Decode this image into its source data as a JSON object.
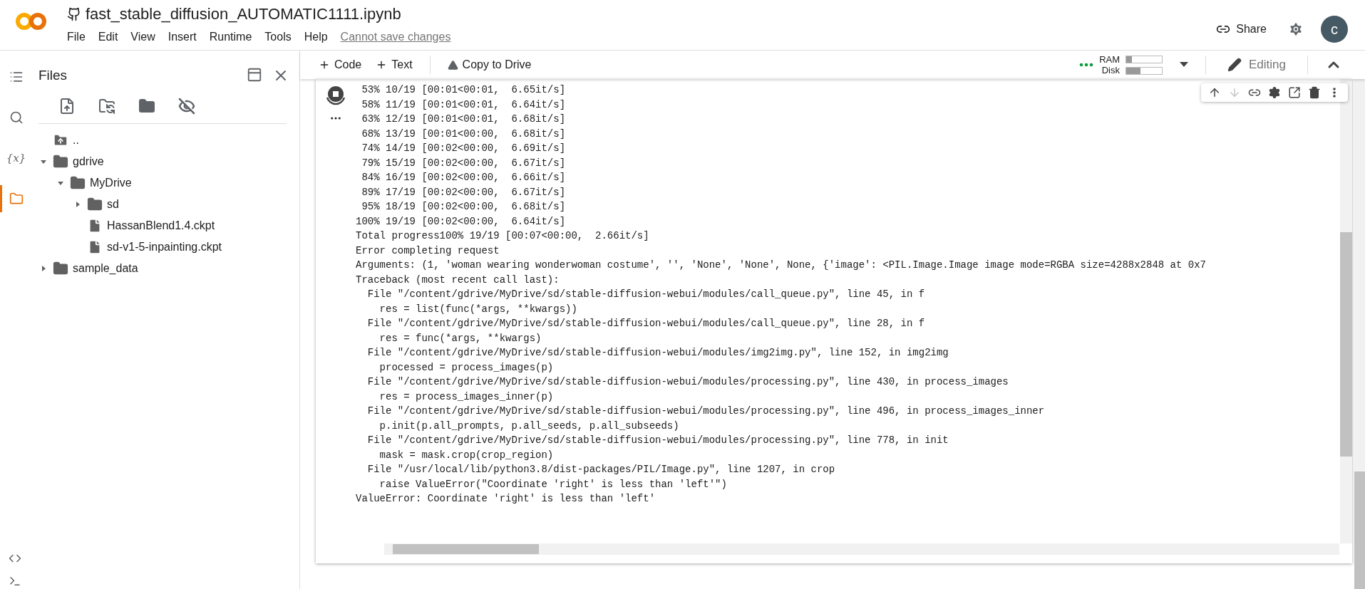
{
  "header": {
    "title": "fast_stable_diffusion_AUTOMATIC1111.ipynb",
    "menu": [
      "File",
      "Edit",
      "View",
      "Insert",
      "Runtime",
      "Tools",
      "Help"
    ],
    "save_notice": "Cannot save changes",
    "share": "Share",
    "avatar": "c"
  },
  "rail": [
    {
      "kind": "toc",
      "selected": false
    },
    {
      "kind": "search",
      "selected": false
    },
    {
      "kind": "variables",
      "glyph": "{x}",
      "selected": false
    },
    {
      "kind": "files",
      "selected": true
    }
  ],
  "files_panel": {
    "title": "Files",
    "tree": [
      {
        "kind": "up",
        "name": ".."
      },
      {
        "kind": "folder",
        "name": "gdrive",
        "expanded": true,
        "children": [
          {
            "kind": "folder",
            "name": "MyDrive",
            "expanded": true,
            "children": [
              {
                "kind": "folder",
                "name": "sd",
                "expanded": false
              },
              {
                "kind": "file",
                "name": "HassanBlend1.4.ckpt"
              },
              {
                "kind": "file",
                "name": "sd-v1-5-inpainting.ckpt"
              }
            ]
          }
        ]
      },
      {
        "kind": "folder",
        "name": "sample_data",
        "expanded": false
      }
    ]
  },
  "toolbar": {
    "buttons": [
      {
        "kind": "add",
        "label": "Code"
      },
      {
        "kind": "add",
        "label": "Text"
      },
      {
        "kind": "drive",
        "label": "Copy to Drive"
      }
    ],
    "ram": {
      "label": "RAM",
      "level": 0.15
    },
    "disk": {
      "label": "Disk",
      "level": 0.4
    },
    "editing": "Editing"
  },
  "cell_toolbar": [
    {
      "kind": "up",
      "disabled": false
    },
    {
      "kind": "down",
      "disabled": true
    },
    {
      "kind": "link",
      "disabled": false
    },
    {
      "kind": "settings",
      "disabled": false
    },
    {
      "kind": "mirror",
      "disabled": false
    },
    {
      "kind": "delete",
      "disabled": false
    },
    {
      "kind": "more",
      "disabled": false
    }
  ],
  "output": [
    " 53% 10/19 [00:01<00:01,  6.65it/s]",
    " 58% 11/19 [00:01<00:01,  6.64it/s]",
    " 63% 12/19 [00:01<00:01,  6.68it/s]",
    " 68% 13/19 [00:01<00:00,  6.68it/s]",
    " 74% 14/19 [00:02<00:00,  6.69it/s]",
    " 79% 15/19 [00:02<00:00,  6.67it/s]",
    " 84% 16/19 [00:02<00:00,  6.66it/s]",
    " 89% 17/19 [00:02<00:00,  6.67it/s]",
    " 95% 18/19 [00:02<00:00,  6.68it/s]",
    "100% 19/19 [00:02<00:00,  6.64it/s]",
    "Total progress100% 19/19 [00:07<00:00,  2.66it/s]",
    "Error completing request",
    "Arguments: (1, 'woman wearing wonderwoman costume', '', 'None', 'None', None, {'image': <PIL.Image.Image image mode=RGBA size=4288x2848 at 0x7",
    "Traceback (most recent call last):",
    "  File \"/content/gdrive/MyDrive/sd/stable-diffusion-webui/modules/call_queue.py\", line 45, in f",
    "    res = list(func(*args, **kwargs))",
    "  File \"/content/gdrive/MyDrive/sd/stable-diffusion-webui/modules/call_queue.py\", line 28, in f",
    "    res = func(*args, **kwargs)",
    "  File \"/content/gdrive/MyDrive/sd/stable-diffusion-webui/modules/img2img.py\", line 152, in img2img",
    "    processed = process_images(p)",
    "  File \"/content/gdrive/MyDrive/sd/stable-diffusion-webui/modules/processing.py\", line 430, in process_images",
    "    res = process_images_inner(p)",
    "  File \"/content/gdrive/MyDrive/sd/stable-diffusion-webui/modules/processing.py\", line 496, in process_images_inner",
    "    p.init(p.all_prompts, p.all_seeds, p.all_subseeds)",
    "  File \"/content/gdrive/MyDrive/sd/stable-diffusion-webui/modules/processing.py\", line 778, in init",
    "    mask = mask.crop(crop_region)",
    "  File \"/usr/local/lib/python3.8/dist-packages/PIL/Image.py\", line 1207, in crop",
    "    raise ValueError(\"Coordinate 'right' is less than 'left'\")",
    "ValueError: Coordinate 'right' is less than 'left'"
  ]
}
